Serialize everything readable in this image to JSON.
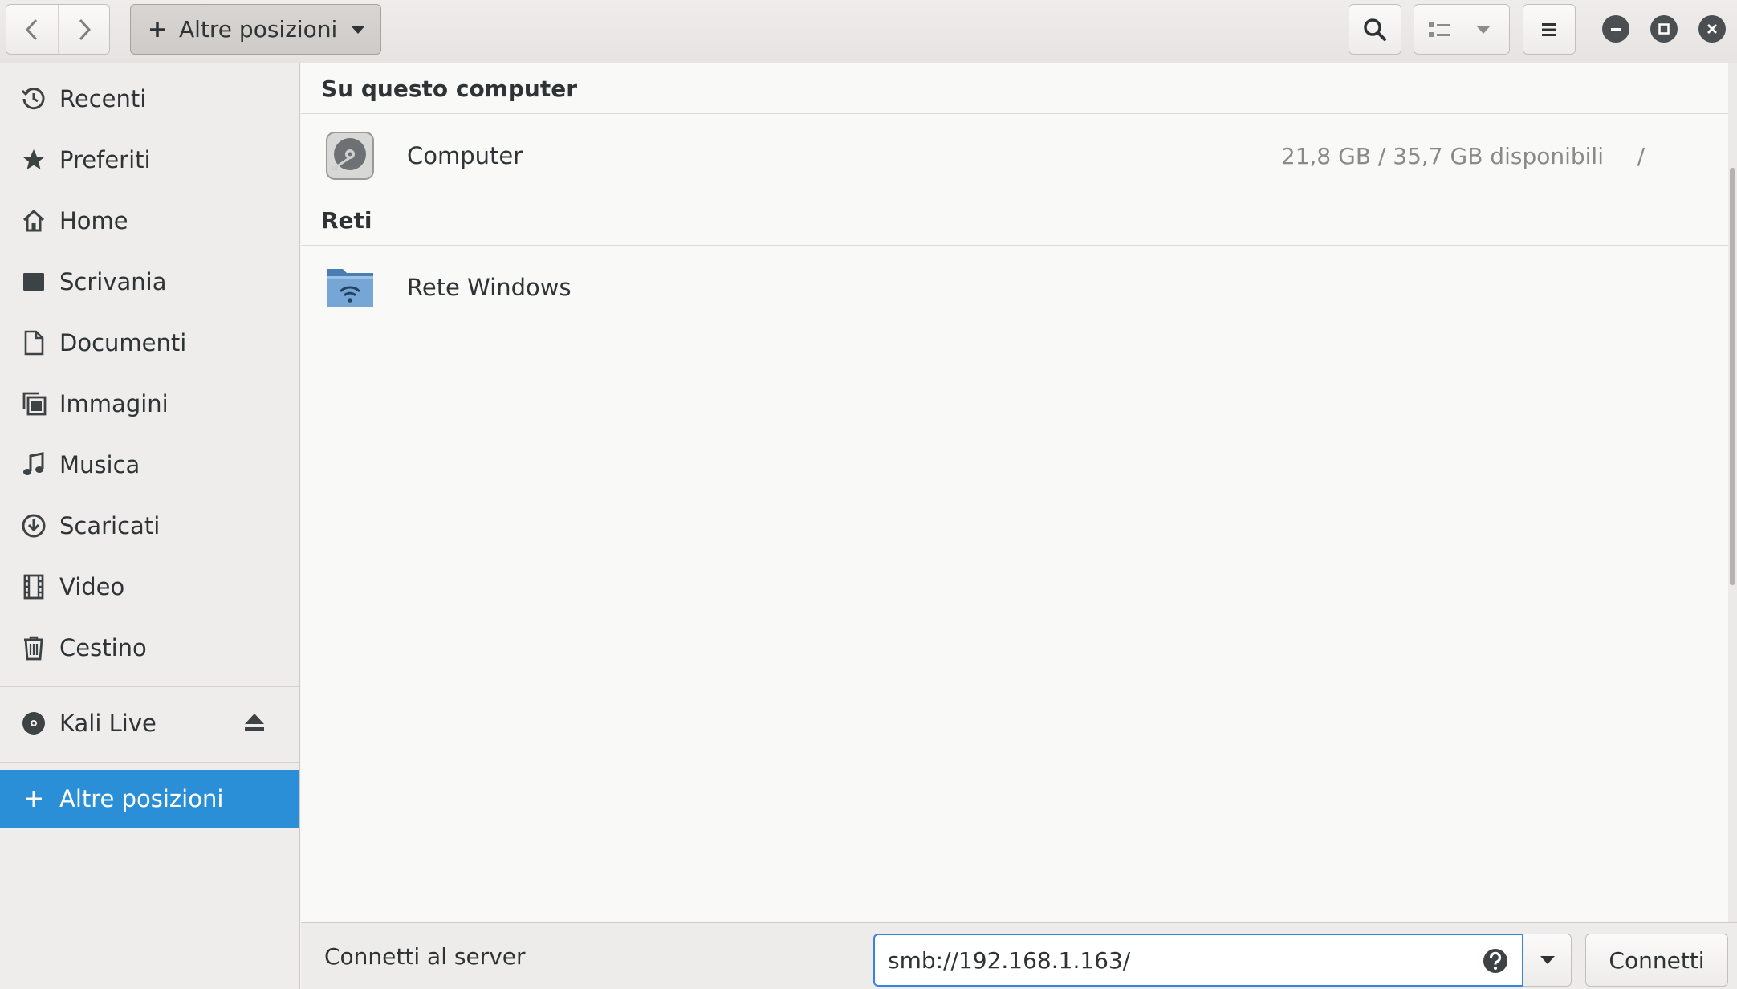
{
  "header": {
    "path_button_label": "Altre posizioni",
    "icons": {
      "back": "chevron-left-icon",
      "forward": "chevron-right-icon",
      "search": "search-icon",
      "view": "list-view-icon",
      "menu": "hamburger-menu-icon"
    }
  },
  "sidebar": {
    "items": [
      {
        "label": "Recenti",
        "icon": "clock-icon"
      },
      {
        "label": "Preferiti",
        "icon": "star-icon"
      },
      {
        "label": "Home",
        "icon": "home-icon"
      },
      {
        "label": "Scrivania",
        "icon": "desktop-icon"
      },
      {
        "label": "Documenti",
        "icon": "document-icon"
      },
      {
        "label": "Immagini",
        "icon": "images-icon"
      },
      {
        "label": "Musica",
        "icon": "music-icon"
      },
      {
        "label": "Scaricati",
        "icon": "download-icon"
      },
      {
        "label": "Video",
        "icon": "video-icon"
      },
      {
        "label": "Cestino",
        "icon": "trash-icon"
      }
    ],
    "devices": [
      {
        "label": "Kali Live",
        "icon": "disc-icon",
        "eject_icon": "eject-icon"
      }
    ],
    "other_locations": {
      "label": "Altre posizioni",
      "icon": "plus-icon"
    }
  },
  "main": {
    "sections": [
      {
        "title": "Su questo computer",
        "items": [
          {
            "name": "Computer",
            "info": "21,8 GB / 35,7 GB disponibili",
            "mount": "/",
            "icon": "harddisk-icon"
          }
        ]
      },
      {
        "title": "Reti",
        "items": [
          {
            "name": "Rete Windows",
            "icon": "network-folder-icon"
          }
        ]
      }
    ]
  },
  "actionbar": {
    "label": "Connetti al server",
    "server_value": "smb://192.168.1.163/",
    "connect_button": "Connetti"
  },
  "colors": {
    "accent": "#2a8fd6",
    "focus": "#3584e4"
  }
}
